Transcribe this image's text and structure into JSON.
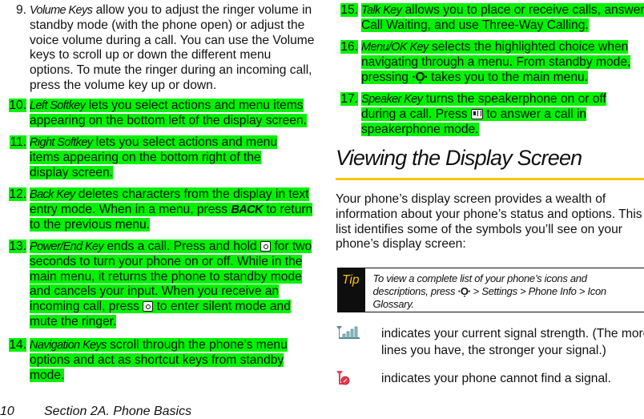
{
  "left_items": [
    {
      "num": "9.",
      "term": "Volume Keys",
      "text": " allow you to adjust the ringer volume in standby mode (with the phone open) or adjust the voice volume during a call. You can use the Volume keys to scroll up or down the different menu options. To mute the ringer during an incoming call, press the volume key up or down.",
      "highlighted": false
    },
    {
      "num": "10.",
      "term": "Left Softkey",
      "text": " lets you select actions and menu items appearing on the bottom left of the display screen.",
      "highlighted": true
    },
    {
      "num": "11.",
      "term": "Right Softkey",
      "text": " lets you select actions and menu items appearing on the bottom right of the display screen.",
      "highlighted": true
    },
    {
      "num": "12.",
      "term": "Back Key",
      "text_a": " deletes characters from the display in text entry mode. When in a menu, press ",
      "key": "BACK",
      "text_b": " to return to the previous menu.",
      "highlighted": true
    },
    {
      "num": "13.",
      "term": "Power/End Key",
      "text_a": " ends a call. Press and hold ",
      "text_b": " for two seconds to turn your phone on or off. While in the main menu, it returns the phone to standby mode and cancels your input. When you receive an incoming call, press ",
      "text_c": " to enter silent mode and mute the ringer.",
      "icon": "power-end-key-icon",
      "highlighted": true
    },
    {
      "num": "14.",
      "term": "Navigation Keys",
      "text": " scroll through the phone’s menu options and act as shortcut keys from standby mode.",
      "highlighted": true
    }
  ],
  "right_items": [
    {
      "num": "15.",
      "term": "Talk Key",
      "text": " allows you to place or receive calls, answer Call Waiting, and use Three-Way Calling.",
      "highlighted": true
    },
    {
      "num": "16.",
      "term": "Menu/OK Key",
      "text_a": " selects the highlighted choice when navigating through a menu. From standby mode, pressing ",
      "text_b": " takes you to the main menu.",
      "icon": "menu-ok-key-icon",
      "highlighted": true
    },
    {
      "num": "17.",
      "term": "Speaker Key",
      "text_a": " turns the speakerphone on or off during a call. Press ",
      "text_b": " to answer a call in speakerphone mode.",
      "icon": "speaker-key-icon",
      "highlighted": true
    }
  ],
  "section": {
    "heading": "Viewing the Display Screen",
    "intro": "Your phone’s display screen provides a wealth of information about your phone’s status and options. This list identifies some of the symbols you’ll see on your phone’s display screen:"
  },
  "tip": {
    "label": "Tip",
    "text_a": "To view a complete list of your phone’s icons and descriptions, press ",
    "text_b": " > Settings > Phone Info > Icon Glossary."
  },
  "icons": [
    {
      "icon": "signal-strength-icon",
      "text": "indicates your current signal strength. (The more lines you have, the stronger your signal.)"
    },
    {
      "icon": "no-signal-icon",
      "text": "indicates your phone cannot find a signal."
    }
  ],
  "nav_glyph": "·Ọ·",
  "footer": {
    "page": "10",
    "section": "Section 2A. Phone Basics"
  },
  "colors": {
    "highlight": "#00f200",
    "accent": "#f7c600",
    "tip_bg": "#0e0e0e"
  }
}
